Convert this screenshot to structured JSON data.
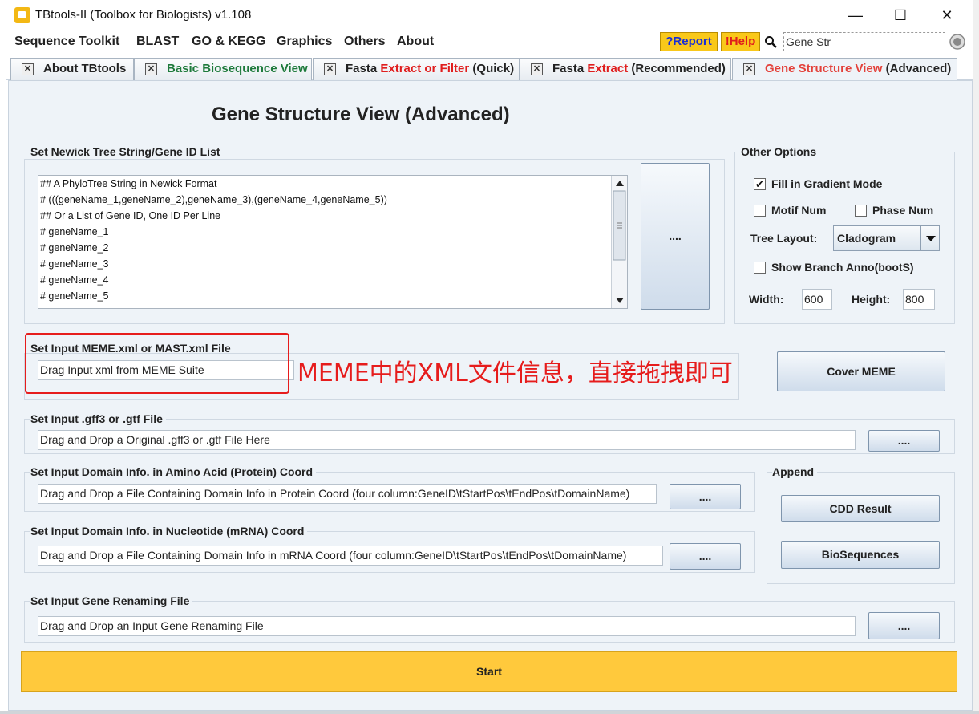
{
  "window": {
    "title": "TBtools-II (Toolbox for Biologists) v1.108",
    "minimize": "—",
    "maximize": "☐",
    "close": "✕"
  },
  "menu": [
    "Sequence Toolkit",
    "BLAST",
    "GO & KEGG",
    "Graphics",
    "Others",
    "About"
  ],
  "toolbar": {
    "report": "?Report",
    "help": "!Help",
    "search_value": "Gene Str"
  },
  "tabs": [
    {
      "label": "About TBtools"
    },
    {
      "label": "Basic Biosequence View"
    },
    {
      "label_a": "Fasta ",
      "label_b": "Extract or Filter",
      "label_c": " (Quick)"
    },
    {
      "label_a": "Fasta ",
      "label_b": "Extract",
      "label_c": " (Recommended)"
    },
    {
      "label_a": "Gene Structure View",
      "label_b": " (Advanced)"
    }
  ],
  "page": {
    "title": "Gene Structure View (Advanced)"
  },
  "newick": {
    "label": "Set Newick Tree String/Gene ID List",
    "lines": [
      "## A PhyloTree String in Newick Format",
      "# (((geneName_1,geneName_2),geneName_3),(geneName_4,geneName_5))",
      "## Or a List of Gene ID, One ID Per Line",
      "# geneName_1",
      "# geneName_2",
      "# geneName_3",
      "# geneName_4",
      "# geneName_5"
    ],
    "browse": "...."
  },
  "options": {
    "label": "Other Options",
    "gradient": "Fill in Gradient Mode",
    "motif_num": "Motif Num",
    "phase_num": "Phase Num",
    "tree_layout_label": "Tree Layout:",
    "tree_layout_value": "Cladogram",
    "branch_anno": "Show Branch Anno(bootS)",
    "width_label": "Width:",
    "width_value": "600",
    "height_label": "Height:",
    "height_value": "800"
  },
  "meme": {
    "label": "Set Input MEME.xml or MAST.xml File",
    "placeholder": "Drag Input xml from MEME Suite",
    "cover_button": "Cover MEME",
    "annotation": "MEME中的XML文件信息，直接拖拽即可"
  },
  "gff": {
    "label": "Set Input .gff3 or .gtf File",
    "placeholder": "Drag and Drop a Original .gff3 or .gtf File Here",
    "browse": "...."
  },
  "domain_protein": {
    "label": "Set Input Domain Info. in Amino Acid (Protein) Coord",
    "placeholder": "Drag and Drop a File Containing Domain Info in Protein Coord (four column:GeneID\\tStartPos\\tEndPos\\tDomainName)",
    "browse": "...."
  },
  "domain_mrna": {
    "label": "Set Input Domain Info. in Nucleotide (mRNA) Coord",
    "placeholder": "Drag and Drop a File Containing Domain Info in mRNA Coord (four column:GeneID\\tStartPos\\tEndPos\\tDomainName)",
    "browse": "...."
  },
  "append": {
    "label": "Append",
    "cdd": "CDD Result",
    "bioseq": "BioSequences"
  },
  "rename": {
    "label": "Set Input Gene Renaming File",
    "placeholder": "Drag and Drop an Input Gene Renaming File",
    "browse": "...."
  },
  "start": "Start"
}
